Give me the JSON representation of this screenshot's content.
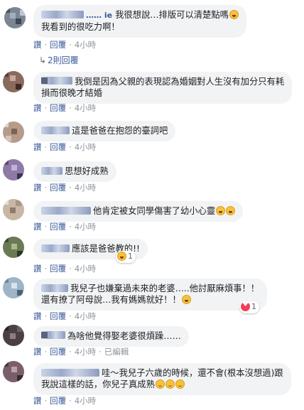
{
  "comments": [
    {
      "name": "…… ie",
      "lines": [
        "我很想說…排版可以清楚點嗎",
        "我看到的很吃力啊！"
      ],
      "time": "4小時"
    },
    {
      "lines": [
        "我倒是因為父親的表現認為婚姻對人生沒有加分只有耗",
        "損而很晚才結婚"
      ],
      "time": "4小時"
    },
    {
      "lines": [
        "這是爸爸在抱怨的臺詞吧"
      ],
      "time": "4小時"
    },
    {
      "lines": [
        "思想好成熟"
      ],
      "time": "4小時"
    },
    {
      "lines": [
        "他肯定被女同學傷害了幼小心靈"
      ],
      "time": "4小時"
    },
    {
      "lines": [
        "應該是爸爸教的!!"
      ],
      "time": "4小時",
      "reaction_count": "1"
    },
    {
      "lines": [
        "我兒子也嫌棄過未來的老婆…..他討厭麻煩事！！",
        "還有撩了阿母說…我有媽媽就好！！"
      ],
      "time": "4小時",
      "reaction_count": "1"
    },
    {
      "lines": [
        "為啥他覺得娶老婆很煩躁……"
      ],
      "time": "4小時",
      "edited": "已編輯"
    },
    {
      "lines": [
        "哇～我兒子六歲的時候，還不會(根本沒想過)跟",
        "我說這樣的話，你兒子真成熟"
      ],
      "time": "4小時"
    }
  ],
  "actions": {
    "like": "讚",
    "reply": "回覆"
  },
  "replies_label": "2則回覆",
  "colors": {
    "link": "#385898",
    "bubble": "#f2f3f5",
    "meta": "#90949c"
  }
}
